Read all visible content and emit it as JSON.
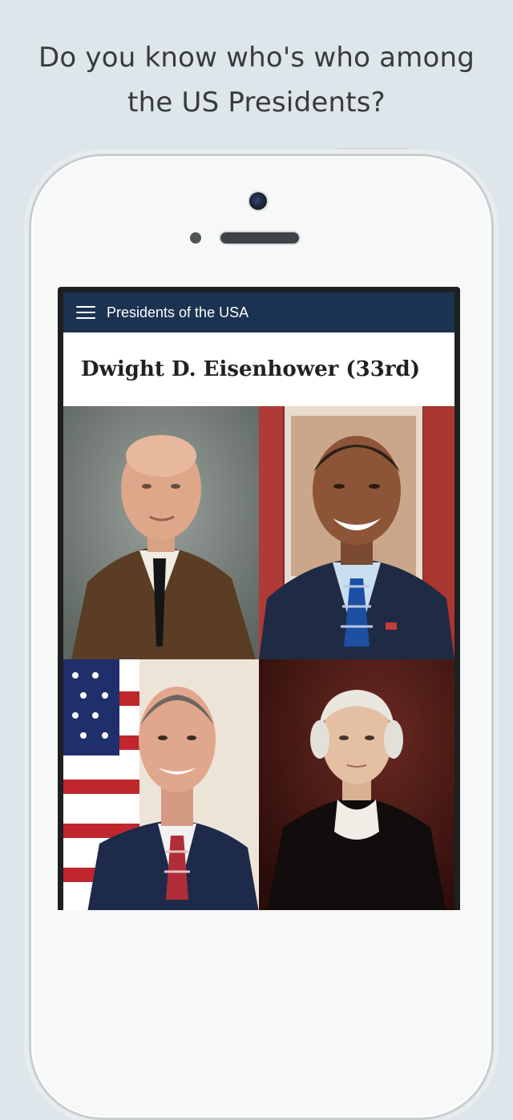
{
  "promo": {
    "line1": "Do you know who's who among",
    "line2": "the US Presidents?"
  },
  "app": {
    "title": "Presidents of the USA",
    "menu_icon": "hamburger-menu-icon"
  },
  "quiz": {
    "question": "Dwight D. Eisenhower (33rd)"
  },
  "colors": {
    "appbar": "#1b3251",
    "background": "#dde6ea"
  }
}
